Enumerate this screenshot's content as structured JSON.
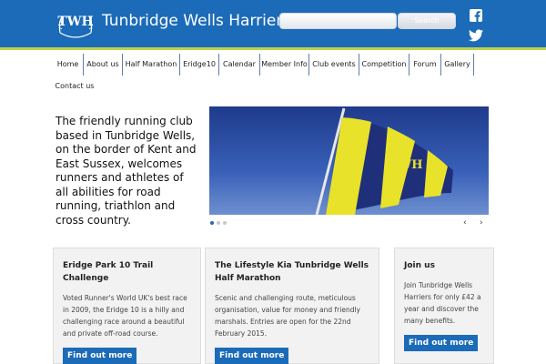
{
  "header": {
    "logo_text": "TWH",
    "site_title": "Tunbridge Wells Harriers",
    "search": {
      "placeholder": "",
      "button_label": "Search"
    },
    "social": [
      "facebook-icon",
      "twitter-icon"
    ],
    "colors": {
      "header_bg": "#1b6bb8",
      "accent_line": "#b9d34a"
    }
  },
  "nav": {
    "items": [
      {
        "label": "Home"
      },
      {
        "label": "About us"
      },
      {
        "label": "Half Marathon"
      },
      {
        "label": "Eridge10"
      },
      {
        "label": "Calendar"
      },
      {
        "label": "Member Info"
      },
      {
        "label": "Club events"
      },
      {
        "label": "Competition"
      },
      {
        "label": "Forum"
      },
      {
        "label": "Gallery"
      },
      {
        "label": "Contact us"
      }
    ]
  },
  "intro": {
    "text": "The friendly running club based in Tunbridge Wells, on the border of Kent and East Sussex, welcomes runners and athletes of all abilities for road running, triathlon and cross country."
  },
  "slider": {
    "flag_text": "TWH",
    "slide_count": 3,
    "active_slide": 1,
    "prev_label": "‹",
    "next_label": "›"
  },
  "cards": [
    {
      "title": "Eridge Park 10 Trail Challenge",
      "body": "Voted Runner's World UK's best race in 2009, the Eridge 10 is a hilly and challenging race around a beautiful and private off-road course.",
      "button": "Find out more"
    },
    {
      "title": "The Lifestyle Kia Tunbridge Wells Half Marathon",
      "body": "Scenic and challenging route, meticulous organisation, value for money and friendly marshals. Entries are open for the 22nd February 2015.",
      "button": "Find out more"
    },
    {
      "title": "Join us",
      "body": "Join Tunbridge Wells Harriers for only £42 a year and discover the many benefits.",
      "button": "Find out more"
    }
  ]
}
